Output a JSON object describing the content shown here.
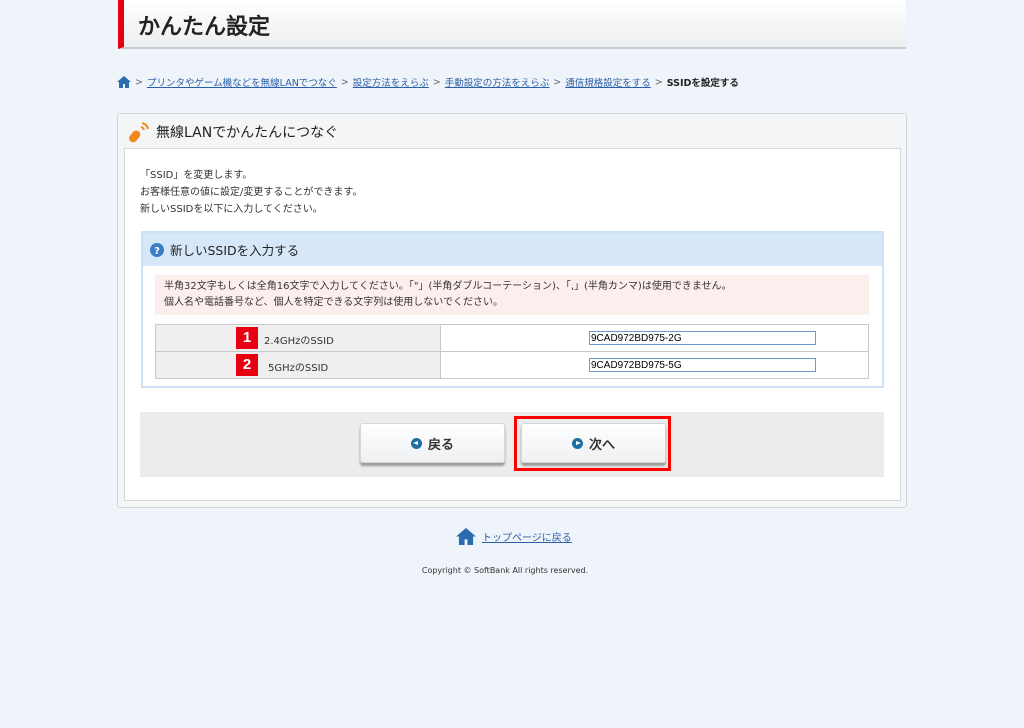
{
  "header": {
    "title": "かんたん設定"
  },
  "breadcrumb": {
    "items": [
      "プリンタやゲーム機などを無線LANでつなぐ",
      "設定方法をえらぶ",
      "手動設定の方法をえらぶ",
      "通信規格設定をする"
    ],
    "current": "SSIDを設定する"
  },
  "panel": {
    "title": "無線LANでかんたんにつなぐ",
    "intro": [
      "「SSID」を変更します。",
      "お客様任意の値に設定/変更することができます。",
      "新しいSSIDを以下に入力してください。"
    ]
  },
  "section": {
    "title": "新しいSSIDを入力する",
    "note": [
      "半角32文字もしくは全角16文字で入力してください。「\"」(半角ダブルコーテーション)、「,」(半角カンマ)は使用できません。",
      "個人名や電話番号など、個人を特定できる文字列は使用しないでください。"
    ],
    "rows": [
      {
        "num": "1",
        "label": "2.4GHzのSSID",
        "value": "9CAD972BD975-2G"
      },
      {
        "num": "2",
        "label": "5GHzのSSID",
        "value": "9CAD972BD975-5G"
      }
    ]
  },
  "buttons": {
    "back": "戻る",
    "next": "次へ"
  },
  "footer": {
    "top_link": "トップページに戻る",
    "copyright": "Copyright © SoftBank All rights reserved."
  },
  "colors": {
    "accent": "#e60012",
    "link": "#2b5fa5",
    "highlight": "#ff0000"
  }
}
